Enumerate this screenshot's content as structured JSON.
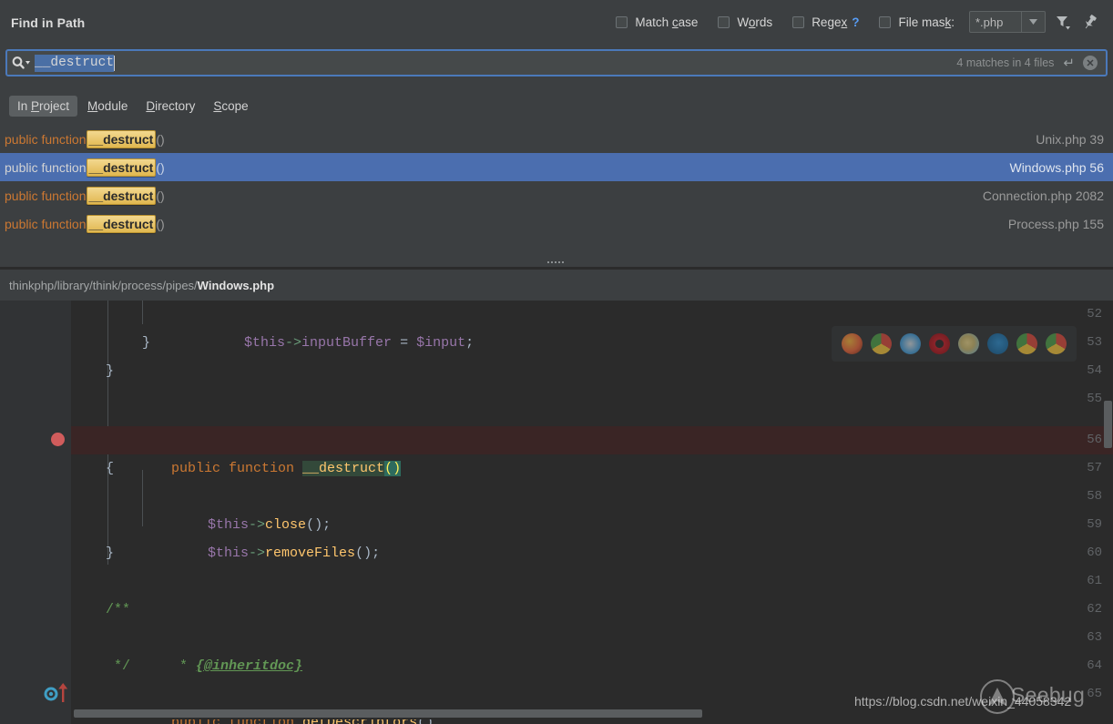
{
  "window": {
    "title": "Find in Path"
  },
  "options": {
    "match_case": {
      "label_pre": "Match ",
      "label_mnemonic": "c",
      "label_post": "ase",
      "checked": false
    },
    "words": {
      "label_pre": "W",
      "label_mnemonic": "o",
      "label_post": "rds",
      "checked": false
    },
    "regex": {
      "label_pre": "Rege",
      "label_mnemonic": "x",
      "label_post": "",
      "checked": false,
      "help": "?"
    },
    "file_mask": {
      "label_pre": "File mas",
      "label_mnemonic": "k",
      "label_post": ":",
      "checked": false,
      "value": "*.php"
    },
    "filter_icon": "filter-funnel-icon",
    "pin_icon": "pushpin-icon"
  },
  "search": {
    "icon": "search-magnifier-icon",
    "query": "__destruct",
    "placeholder": "",
    "match_summary": "4 matches in 4 files",
    "enter_icon": "↵",
    "clear_icon": "✕"
  },
  "scope_tabs": [
    {
      "pre": "In ",
      "mnemonic": "P",
      "post": "roject",
      "selected": true
    },
    {
      "pre": "",
      "mnemonic": "M",
      "post": "odule",
      "selected": false
    },
    {
      "pre": "",
      "mnemonic": "D",
      "post": "irectory",
      "selected": false
    },
    {
      "pre": "",
      "mnemonic": "S",
      "post": "cope",
      "selected": false
    }
  ],
  "results": [
    {
      "prefix": "public function ",
      "match": "__destruct",
      "suffix": "()",
      "file": "Unix.php",
      "line": "39",
      "selected": false
    },
    {
      "prefix": "public function ",
      "match": "__destruct",
      "suffix": "()",
      "file": "Windows.php",
      "line": "56",
      "selected": true
    },
    {
      "prefix": "public function ",
      "match": "__destruct",
      "suffix": "()",
      "file": "Connection.php",
      "line": "2082",
      "selected": false
    },
    {
      "prefix": "public function ",
      "match": "__destruct",
      "suffix": "()",
      "file": "Process.php",
      "line": "155",
      "selected": false
    }
  ],
  "preview": {
    "path_dir": "thinkphp/library/think/process/pipes/",
    "path_file": "Windows.php",
    "lines": [
      {
        "num": "52"
      },
      {
        "num": "53"
      },
      {
        "num": "54"
      },
      {
        "num": "55"
      },
      {
        "num": "56"
      },
      {
        "num": "57"
      },
      {
        "num": "58"
      },
      {
        "num": "59"
      },
      {
        "num": "60"
      },
      {
        "num": "61"
      },
      {
        "num": "62"
      },
      {
        "num": "63"
      },
      {
        "num": "64"
      },
      {
        "num": "65"
      }
    ],
    "code": {
      "l52_var1": "$this",
      "l52_arrow": "->",
      "l52_prop": "inputBuffer",
      "l52_eq": " = ",
      "l52_var2": "$input",
      "l52_semi": ";",
      "l53": "}",
      "l54": "}",
      "l56_kw": "public function ",
      "l56_name": "__destruct",
      "l56_parens": "()",
      "l57": "{",
      "l58_var": "$this",
      "l58_arrow": "->",
      "l58_fn": "close",
      "l58_tail": "();",
      "l59_var": "$this",
      "l59_arrow": "->",
      "l59_fn": "removeFiles",
      "l59_tail": "();",
      "l60": "}",
      "l62": "/**",
      "l63_star": "* ",
      "l63_tag": "{@inheritdoc}",
      "l64": "*/",
      "l65_kw": "public function ",
      "l65_fn": "getDescriptors",
      "l65_parens": "()"
    },
    "breakpoint_line": "56",
    "override_marker_line": "65"
  },
  "browsers": [
    {
      "name": "firefox-icon",
      "c1": "#e8663c",
      "c2": "#f2b33d"
    },
    {
      "name": "chrome-icon",
      "c1": "#d94a3d",
      "c2": "#4fa04a"
    },
    {
      "name": "safari-icon",
      "c1": "#4a9fd8",
      "c2": "#cfd8de"
    },
    {
      "name": "opera-icon",
      "c1": "#c8202a",
      "c2": "#8d1016"
    },
    {
      "name": "ie-icon",
      "c1": "#e8d48a",
      "c2": "#6bb6dd"
    },
    {
      "name": "edge-icon",
      "c1": "#2f8fcf",
      "c2": "#1c6aa0"
    },
    {
      "name": "chrome-icon-2",
      "c1": "#d94a3d",
      "c2": "#4fa04a"
    },
    {
      "name": "chrome-icon-3",
      "c1": "#d94a3d",
      "c2": "#4fa04a"
    }
  ],
  "watermark": {
    "url": "https://blog.csdn.net/weixin_44058342",
    "brand": "Seebug"
  },
  "colors": {
    "accent": "#4b6eaf",
    "highlight": "#e0b74f",
    "keyword": "#cc7832",
    "editor_bg": "#2b2b2b",
    "panel_bg": "#3c3f41",
    "breakpoint": "#d05c5c"
  }
}
